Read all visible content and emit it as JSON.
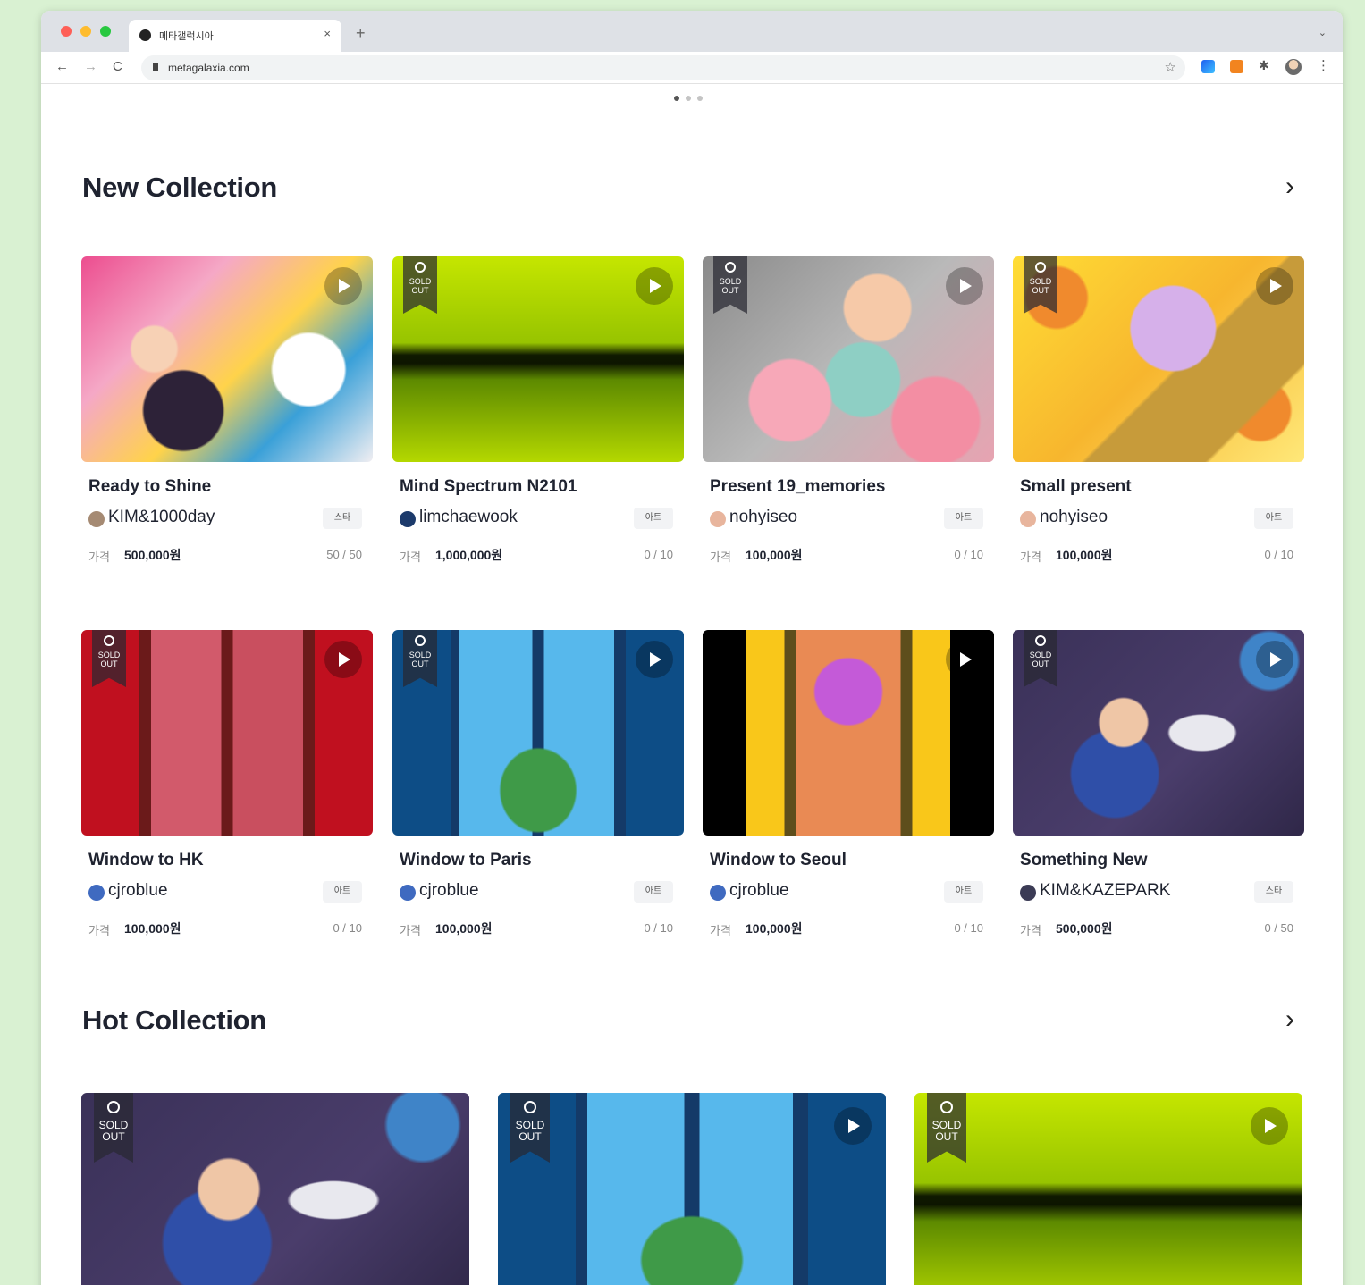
{
  "browser": {
    "tab_title": "메타갤럭시아",
    "tab_close": "×",
    "new_tab": "+",
    "tab_menu": "⌄",
    "url": "metagalaxia.com",
    "back": "←",
    "forward": "→",
    "reload": "C",
    "star": "☆",
    "puzzle": "✱",
    "more": "⋮"
  },
  "sections": {
    "new_collection": {
      "title": "New Collection",
      "arrow": "›"
    },
    "hot_collection": {
      "title": "Hot Collection",
      "arrow": "›"
    }
  },
  "new_collection": [
    {
      "title": "Ready to Shine",
      "artist": "KIM&1000day",
      "category": "스타",
      "price_label": "가격",
      "price": "500,000원",
      "edition": "50 / 50",
      "sold_out": false,
      "art": "shine"
    },
    {
      "title": "Mind Spectrum N2101",
      "artist": "limchaewook",
      "category": "아트",
      "price_label": "가격",
      "price": "1,000,000원",
      "edition": "0 / 10",
      "sold_out": true,
      "art": "spectrum"
    },
    {
      "title": "Present 19_memories",
      "artist": "nohyiseo",
      "category": "아트",
      "price_label": "가격",
      "price": "100,000원",
      "edition": "0 / 10",
      "sold_out": true,
      "art": "memories"
    },
    {
      "title": "Small present",
      "artist": "nohyiseo",
      "category": "아트",
      "price_label": "가격",
      "price": "100,000원",
      "edition": "0 / 10",
      "sold_out": true,
      "art": "small"
    },
    {
      "title": "Window to HK",
      "artist": "cjroblue",
      "category": "아트",
      "price_label": "가격",
      "price": "100,000원",
      "edition": "0 / 10",
      "sold_out": true,
      "art": "hk"
    },
    {
      "title": "Window to Paris",
      "artist": "cjroblue",
      "category": "아트",
      "price_label": "가격",
      "price": "100,000원",
      "edition": "0 / 10",
      "sold_out": true,
      "art": "paris"
    },
    {
      "title": "Window to Seoul",
      "artist": "cjroblue",
      "category": "아트",
      "price_label": "가격",
      "price": "100,000원",
      "edition": "0 / 10",
      "sold_out": false,
      "art": "seoul"
    },
    {
      "title": "Something New",
      "artist": "KIM&KAZEPARK",
      "category": "스타",
      "price_label": "가격",
      "price": "500,000원",
      "edition": "0 / 50",
      "sold_out": true,
      "art": "new"
    }
  ],
  "hot_collection": [
    {
      "sold_out": true,
      "art": "new",
      "play": false
    },
    {
      "sold_out": true,
      "art": "paris",
      "play": true
    },
    {
      "sold_out": true,
      "art": "spectrum",
      "play": true
    }
  ],
  "badge_text": "SOLD\nOUT"
}
